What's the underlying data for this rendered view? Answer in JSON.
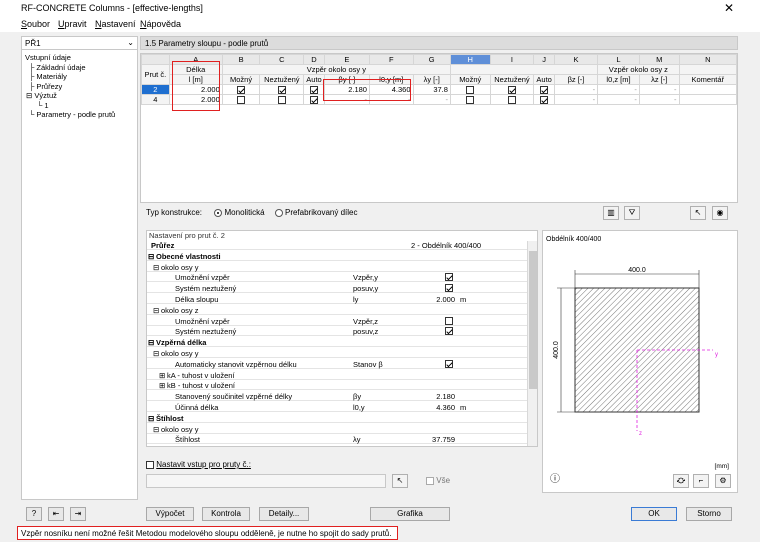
{
  "window": {
    "title": "RF-CONCRETE Columns - [effective-lengths]",
    "close": "✕"
  },
  "menu": [
    "Soubor",
    "Upravit",
    "Nastavení",
    "Nápověda"
  ],
  "nav": {
    "selector": "PŘ1",
    "tree": [
      "Vstupní údaje",
      "Základní údaje",
      "Materiály",
      "Průřezy",
      "Výztuž",
      "1",
      "Parametry - podle prutů"
    ]
  },
  "section_title": "1.5 Parametry sloupu - podle prutů",
  "grid": {
    "letters": [
      "A",
      "B",
      "C",
      "D",
      "E",
      "F",
      "G",
      "H",
      "I",
      "J",
      "K",
      "L",
      "M",
      "N"
    ],
    "group_y": "Vzpěr okolo osy y",
    "group_z": "Vzpěr okolo osy z",
    "headers": {
      "prut": "Prut č.",
      "delka": "Délka",
      "delka_unit": "l [m]",
      "mozny": "Možný",
      "neztuzeny": "Neztužený",
      "auto": "Auto",
      "beta_y": "βy [-]",
      "l0y": "l0,y [m]",
      "lambda_y": "λy [-]",
      "beta_z": "βz [-]",
      "l0z": "l0,z [m]",
      "lambda_z": "λz [-]",
      "komentar": "Komentář"
    },
    "rows": [
      {
        "prut": "2",
        "delka": "2.000",
        "mozny_y": true,
        "neztuzeny_y": true,
        "auto_y": true,
        "beta_y": "2.180",
        "l0y": "4.360",
        "lambda_y": "37.8",
        "mozny_z": false,
        "neztuzeny_z": true,
        "auto_z": true,
        "beta_z": "-",
        "l0z": "-",
        "lambda_z": "-"
      },
      {
        "prut": "4",
        "delka": "2.000",
        "mozny_y": false,
        "neztuzeny_y": false,
        "auto_y": true,
        "beta_y": "-",
        "l0y": "-",
        "lambda_y": "-",
        "mozny_z": false,
        "neztuzeny_z": false,
        "auto_z": true,
        "beta_z": "-",
        "l0z": "-",
        "lambda_z": "-"
      }
    ]
  },
  "typ": {
    "label": "Typ konstrukce:",
    "opt1": "Monolitická",
    "opt2": "Prefabrikovaný dílec"
  },
  "props": {
    "title": "Nastavení pro prut č. 2",
    "rows": [
      {
        "kind": "head",
        "name": "Průřez",
        "value": "2 - Obdélník 400/400"
      },
      {
        "kind": "grp",
        "name": "Obecné vlastnosti"
      },
      {
        "kind": "sub",
        "name": "okolo osy y"
      },
      {
        "kind": "item",
        "name": "Umožnění vzpěr",
        "sym": "Vzpěr,y",
        "check": true
      },
      {
        "kind": "item",
        "name": "Systém neztužený",
        "sym": "posuv,y",
        "check": true
      },
      {
        "kind": "item",
        "name": "Délka sloupu",
        "sym": "ly",
        "val": "2.000",
        "unit": "m"
      },
      {
        "kind": "sub",
        "name": "okolo osy z"
      },
      {
        "kind": "item",
        "name": "Umožnění vzpěr",
        "sym": "Vzpěr,z",
        "check": false
      },
      {
        "kind": "item",
        "name": "Systém neztužený",
        "sym": "posuv,z",
        "check": true
      },
      {
        "kind": "grp",
        "name": "Vzpěrná délka"
      },
      {
        "kind": "sub",
        "name": "okolo osy y"
      },
      {
        "kind": "item",
        "name": "Automaticky stanovit vzpěrnou délku",
        "sym": "Stanov β",
        "check": true
      },
      {
        "kind": "sub2",
        "name": "kA - tuhost v uložení"
      },
      {
        "kind": "sub2",
        "name": "kB - tuhost v uložení"
      },
      {
        "kind": "item",
        "name": "Stanovený součinitel vzpěrné délky",
        "sym": "βy",
        "val": "2.180"
      },
      {
        "kind": "item",
        "name": "Účinná délka",
        "sym": "l0,y",
        "val": "4.360",
        "unit": "m"
      },
      {
        "kind": "grp",
        "name": "Štíhlost"
      },
      {
        "kind": "sub",
        "name": "okolo osy y"
      },
      {
        "kind": "item",
        "name": "Štíhlost",
        "sym": "λy",
        "val": "37.759"
      }
    ]
  },
  "preview": {
    "title": "Obdélník 400/400",
    "dim_top": "400.0",
    "dim_left": "400.0",
    "axis_y": "y",
    "axis_z": "z",
    "unit": "[mm]"
  },
  "nastavit": "Nastavit vstup pro pruty č.:",
  "vse": "Vše",
  "buttons": {
    "vypocet": "Výpočet",
    "kontrola": "Kontrola",
    "detaily": "Detaily...",
    "grafika": "Grafika",
    "ok": "OK",
    "storno": "Storno"
  },
  "status": "Vzpěr nosníku není možné řešit Metodou modelového sloupu odděleně, je nutne ho spojit do sady prutů."
}
